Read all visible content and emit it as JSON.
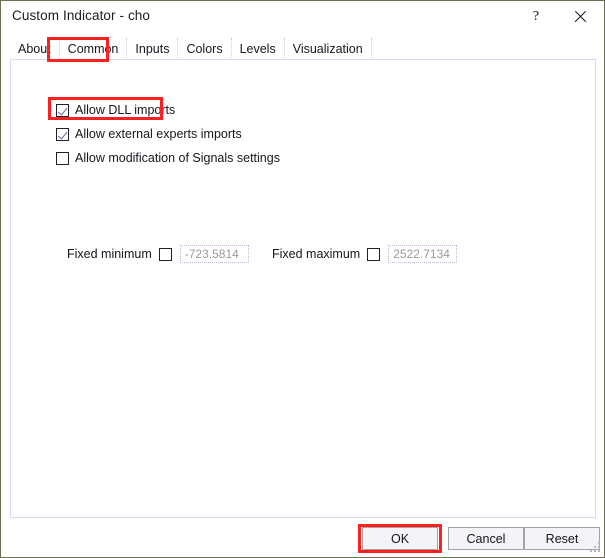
{
  "window": {
    "title": "Custom Indicator - cho",
    "help_label": "?",
    "close_label": "",
    "accent_red": "#fc2020",
    "border_color": "#6e6f52",
    "panel_border_color": "#d9d9ef"
  },
  "tabs": [
    {
      "label": "About",
      "selected": false
    },
    {
      "label": "Common",
      "selected": true
    },
    {
      "label": "Inputs",
      "selected": false
    },
    {
      "label": "Colors",
      "selected": false
    },
    {
      "label": "Levels",
      "selected": false
    },
    {
      "label": "Visualization",
      "selected": false
    }
  ],
  "common_tab": {
    "checkboxes": [
      {
        "label": "Allow DLL imports",
        "checked": true
      },
      {
        "label": "Allow external experts imports",
        "checked": true
      },
      {
        "label": "Allow modification of Signals settings",
        "checked": false
      }
    ],
    "fixed_minimum": {
      "label": "Fixed minimum",
      "checked": false,
      "value": "-723.5814",
      "disabled": true
    },
    "fixed_maximum": {
      "label": "Fixed maximum",
      "checked": false,
      "value": "2522.7134",
      "disabled": true
    }
  },
  "footer": {
    "ok_label": "OK",
    "cancel_label": "Cancel",
    "reset_label": "Reset"
  },
  "annotations": [
    {
      "name": "tab-common-highlight",
      "color": "#fc2020"
    },
    {
      "name": "dll-imports-highlight",
      "color": "#fc2020"
    },
    {
      "name": "ok-button-highlight",
      "color": "#fc2020"
    }
  ]
}
